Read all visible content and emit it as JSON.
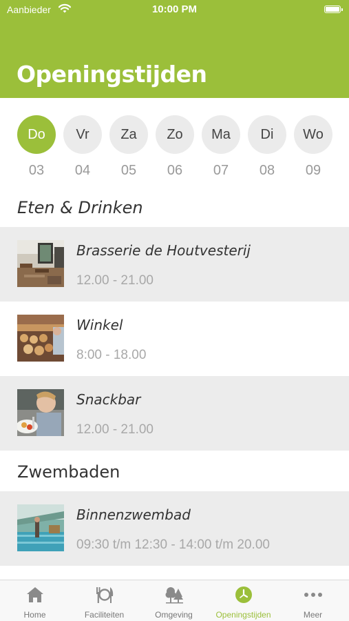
{
  "status_bar": {
    "carrier": "Aanbieder",
    "time": "10:00 PM"
  },
  "header": {
    "title": "Openingstijden",
    "color": "#9bbf3a"
  },
  "days": [
    {
      "label": "Do",
      "date": "03",
      "active": true
    },
    {
      "label": "Vr",
      "date": "04",
      "active": false
    },
    {
      "label": "Za",
      "date": "05",
      "active": false
    },
    {
      "label": "Zo",
      "date": "06",
      "active": false
    },
    {
      "label": "Ma",
      "date": "07",
      "active": false
    },
    {
      "label": "Di",
      "date": "08",
      "active": false
    },
    {
      "label": "Wo",
      "date": "09",
      "active": false
    }
  ],
  "sections": [
    {
      "title": "Eten & Drinken",
      "venues": [
        {
          "name": "Brasserie de Houtvesterij",
          "hours": "12.00 - 21.00",
          "image": "brasserie-photo"
        },
        {
          "name": "Winkel",
          "hours": "8:00 - 18.00",
          "image": "shop-photo"
        },
        {
          "name": "Snackbar",
          "hours": "12.00 - 21.00",
          "image": "snackbar-photo"
        }
      ]
    },
    {
      "title": "Zwembaden",
      "venues": [
        {
          "name": "Binnenzwembad",
          "hours": "09:30 t/m 12:30 - 14:00 t/m 20.00",
          "image": "pool-photo"
        }
      ]
    }
  ],
  "tab_bar": [
    {
      "label": "Home",
      "icon": "home-icon",
      "active": false
    },
    {
      "label": "Faciliteiten",
      "icon": "cutlery-icon",
      "active": false
    },
    {
      "label": "Omgeving",
      "icon": "trees-icon",
      "active": false
    },
    {
      "label": "Openingstijden",
      "icon": "clock-icon",
      "active": true
    },
    {
      "label": "Meer",
      "icon": "more-icon",
      "active": false
    }
  ]
}
